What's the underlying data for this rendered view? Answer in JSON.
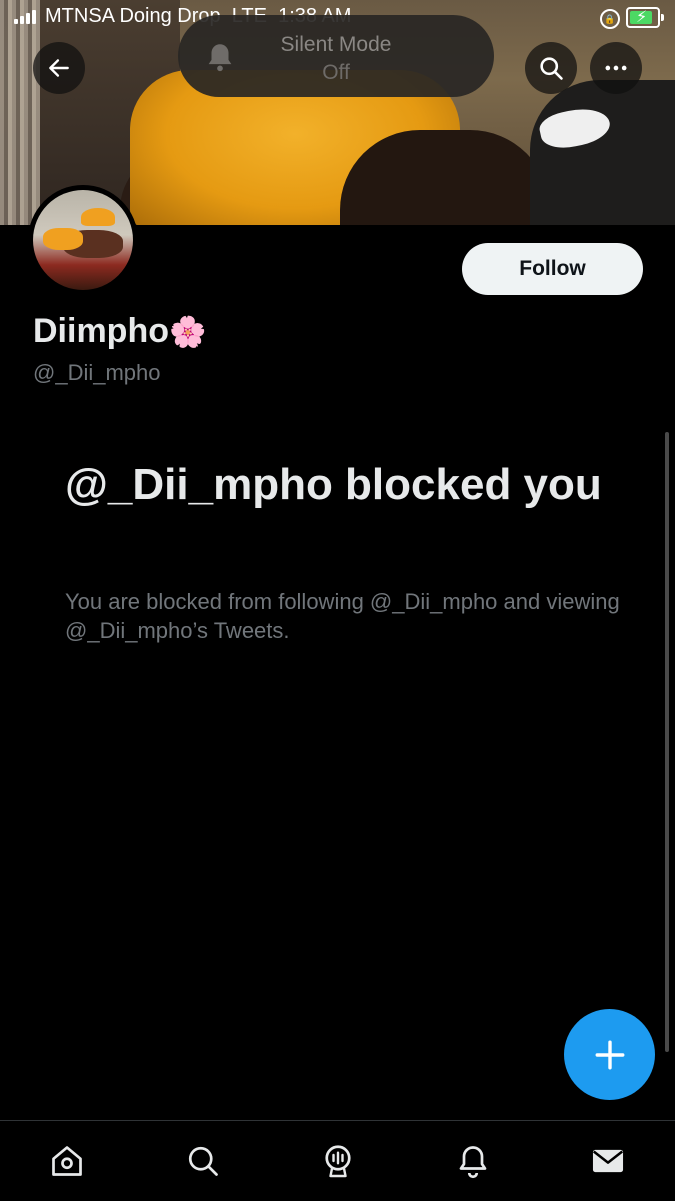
{
  "status_bar": {
    "carrier": "MTNSA Doing Drop",
    "network": "LTE",
    "time": "1:38 AM"
  },
  "silent_mode": {
    "title": "Silent Mode",
    "state": "Off"
  },
  "profile": {
    "display_name": "Diimpho",
    "name_emoji": "🌸",
    "handle": "@_Dii_mpho",
    "follow_label": "Follow"
  },
  "blocked": {
    "title": "@_Dii_mpho blocked you",
    "description": "You are blocked from following @_Dii_mpho and viewing @_Dii_mpho’s Tweets."
  },
  "colors": {
    "accent": "#1d9bf0",
    "background": "#000000",
    "secondary_text": "#71767b",
    "battery": "#4cd964"
  },
  "icons": {
    "back": "arrow-left-icon",
    "search": "search-icon",
    "more": "more-horizontal-icon",
    "compose": "plus-icon",
    "tabs": [
      "home-icon",
      "search-icon",
      "spaces-icon",
      "notifications-icon",
      "messages-icon"
    ]
  }
}
